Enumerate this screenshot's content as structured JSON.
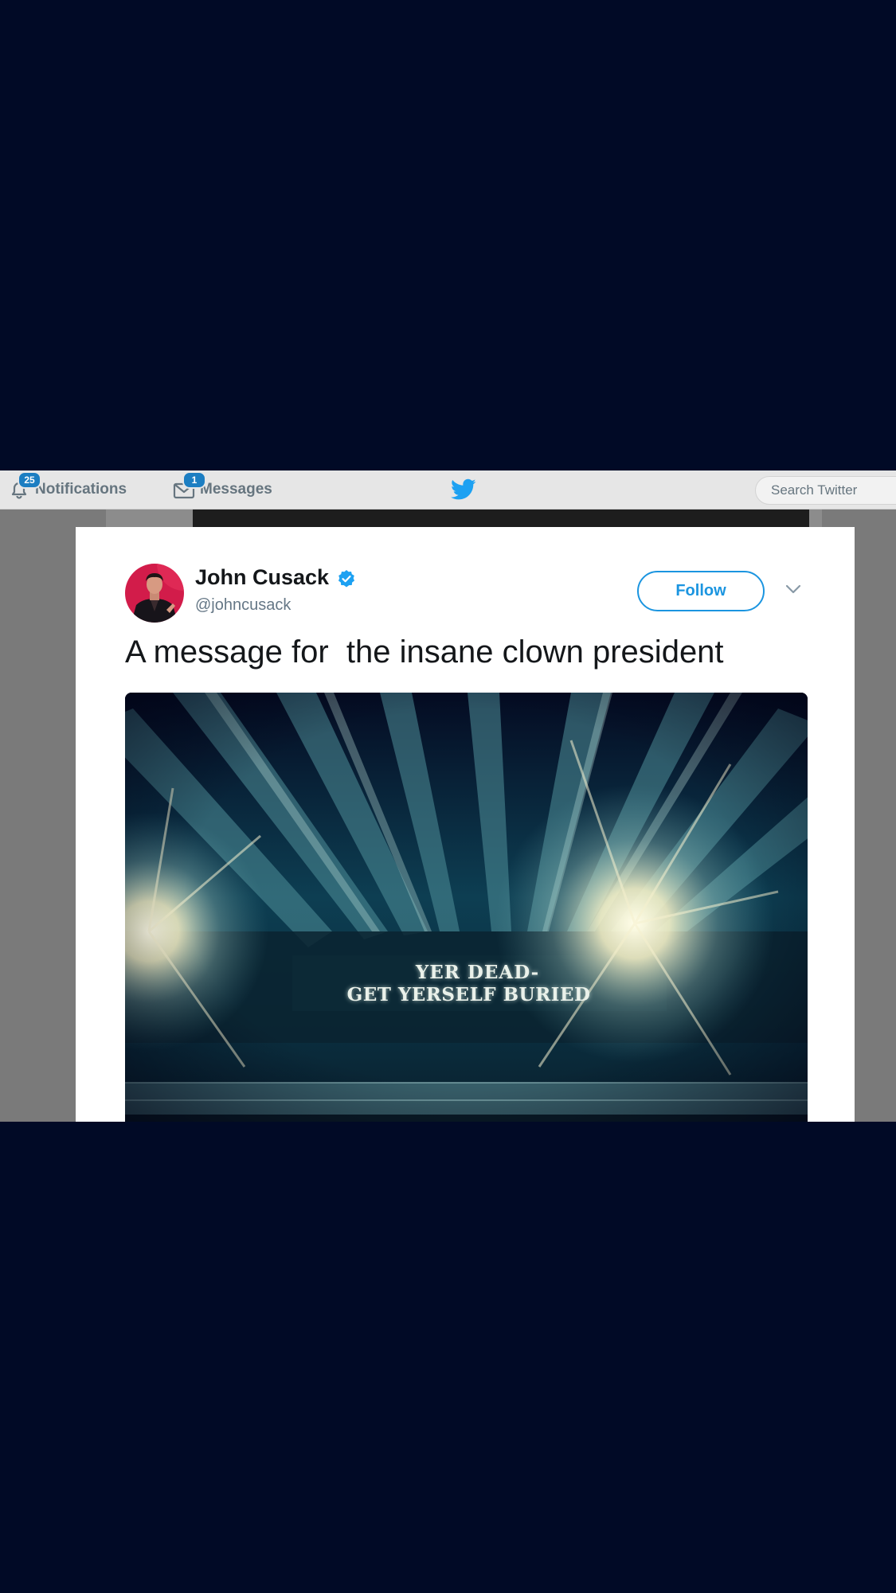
{
  "topbar": {
    "notifications": {
      "label": "Notifications",
      "badge": "25",
      "icon": "bell-icon"
    },
    "messages": {
      "label": "Messages",
      "badge": "1",
      "icon": "envelope-icon"
    },
    "logo": "twitter-bird-icon",
    "search": {
      "placeholder": "Search Twitter",
      "value": ""
    }
  },
  "tweet": {
    "author": {
      "name": "John Cusack",
      "handle": "@johncusack",
      "verified": true,
      "verified_icon": "verified-badge-icon",
      "avatar": "avatar"
    },
    "follow_label": "Follow",
    "more_icon": "chevron-down-icon",
    "text": "A message for  the insane clown president",
    "photo": {
      "line1": "YER DEAD-",
      "line2": "GET YERSELF BURIED"
    }
  },
  "colors": {
    "page_background": "#010a26",
    "twitter_blue": "#1b95e0",
    "badge_blue": "#1c7ec2",
    "nav_gray": "#66757f",
    "text_dark": "#14171a",
    "handle_gray": "#657786"
  }
}
